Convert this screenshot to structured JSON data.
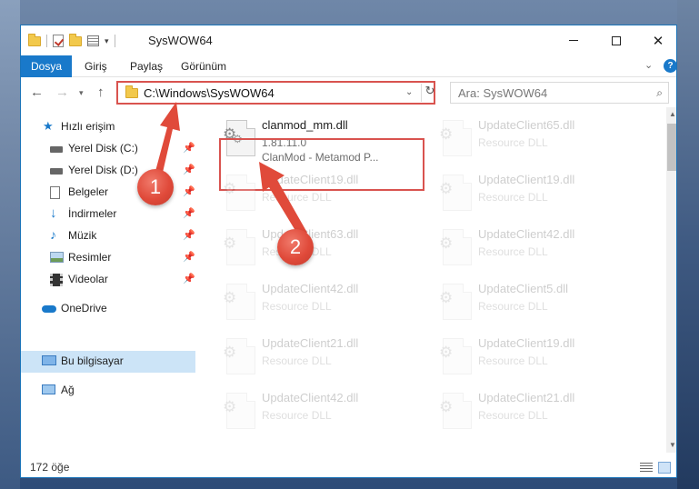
{
  "window": {
    "title": "SysWOW64",
    "controls": {
      "minimize": "—",
      "maximize": "",
      "close": "✕"
    }
  },
  "ribbon": {
    "tabs": [
      {
        "label": "Dosya",
        "active": true
      },
      {
        "label": "Giriş"
      },
      {
        "label": "Paylaş"
      },
      {
        "label": "Görünüm"
      }
    ],
    "help": "?"
  },
  "navigation": {
    "address": "C:\\Windows\\SysWOW64",
    "search_placeholder": "Ara: SysWOW64"
  },
  "sidebar": {
    "items": [
      {
        "label": "Hızlı erişim",
        "icon": "star-icon",
        "pinned": false
      },
      {
        "label": "Yerel Disk (C:)",
        "icon": "drive-icon",
        "pinned": true
      },
      {
        "label": "Yerel Disk (D:)",
        "icon": "drive-icon",
        "pinned": true
      },
      {
        "label": "Belgeler",
        "icon": "documents-icon",
        "pinned": true
      },
      {
        "label": "İndirmeler",
        "icon": "download-icon",
        "pinned": true
      },
      {
        "label": "Müzik",
        "icon": "music-icon",
        "pinned": true
      },
      {
        "label": "Resimler",
        "icon": "pictures-icon",
        "pinned": true
      },
      {
        "label": "Videolar",
        "icon": "video-icon",
        "pinned": true
      },
      {
        "label": "OneDrive",
        "icon": "cloud-icon",
        "pinned": false
      },
      {
        "label": "Bu bilgisayar",
        "icon": "computer-icon",
        "pinned": false,
        "selected": true
      },
      {
        "label": "Ağ",
        "icon": "network-icon",
        "pinned": false
      }
    ]
  },
  "files": [
    {
      "name": "clanmod_mm.dll",
      "version": "1.81.11.0",
      "description": "ClanMod - Metamod P...",
      "highlighted": true
    },
    {
      "name": "UpdateClient65.dll",
      "description": "Resource DLL"
    },
    {
      "name": "UpdateClient19.dll",
      "description": "Resource DLL"
    },
    {
      "name": "UpdateClient19.dll",
      "description": "Resource DLL"
    },
    {
      "name": "UpdateClient42.dll",
      "description": "Resource DLL"
    },
    {
      "name": "UpdateClient63.dll",
      "description": "Resource DLL"
    },
    {
      "name": "UpdateClient42.dll",
      "description": "Resource DLL"
    },
    {
      "name": "UpdateClient42.dll",
      "description": "Resource DLL"
    },
    {
      "name": "UpdateClient5.dll",
      "description": "Resource DLL"
    },
    {
      "name": "UpdateClient21.dll",
      "description": "Resource DLL"
    },
    {
      "name": "UpdateClient19.dll",
      "description": "Resource DLL"
    },
    {
      "name": "UpdateClient42.dll",
      "description": "Resource DLL"
    },
    {
      "name": "UpdateClient21.dll",
      "description": "Resource DLL"
    }
  ],
  "status": {
    "count": "172 öğe"
  },
  "annotations": {
    "marker1": "1",
    "marker2": "2",
    "color": "#e04a3a"
  }
}
